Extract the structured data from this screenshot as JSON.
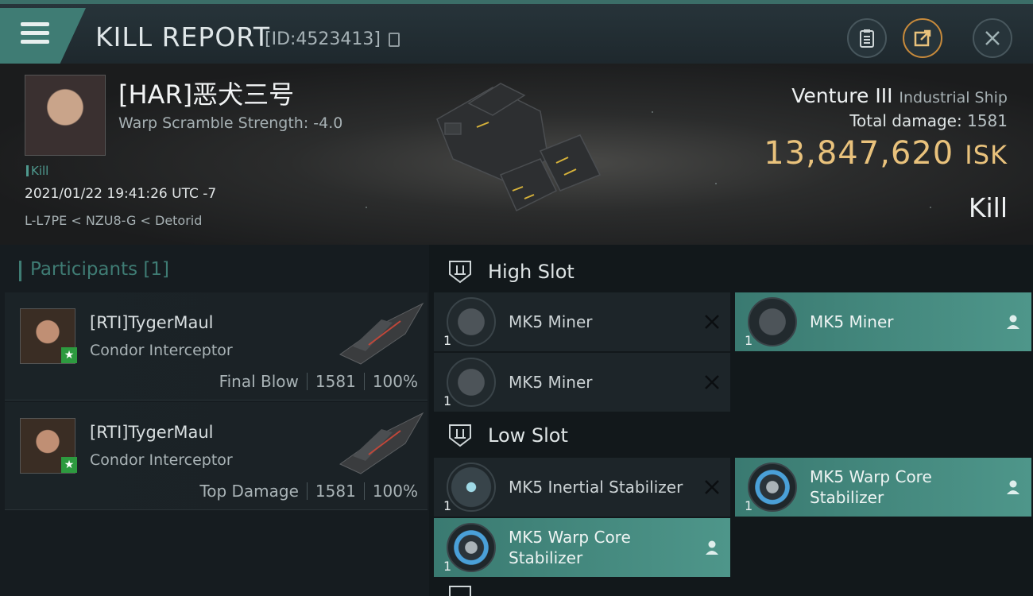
{
  "header": {
    "title": "KILL REPORT",
    "report_id": "[ID:4523413]",
    "buttons": [
      "clipboard-icon",
      "share-icon",
      "close-icon"
    ]
  },
  "victim": {
    "name": "[HAR]恶犬三号",
    "warp_scramble": "Warp Scramble Strength: -4.0",
    "tag": "Kill",
    "datetime": "2021/01/22 19:41:26 UTC -7",
    "location": "L-L7PE < NZU8-G < Detorid",
    "ship": "Venture III",
    "ship_class": "Industrial Ship",
    "total_damage_label": "Total damage:",
    "total_damage": "1581",
    "isk_value": "13,847,620",
    "isk_unit": "ISK",
    "kill_type": "Kill"
  },
  "participants": {
    "heading": "Participants [1]",
    "items": [
      {
        "name": "[RTI]TygerMaul",
        "ship": "Condor Interceptor",
        "role": "Final Blow",
        "damage": "1581",
        "percent": "100%"
      },
      {
        "name": "[RTI]TygerMaul",
        "ship": "Condor Interceptor",
        "role": "Top Damage",
        "damage": "1581",
        "percent": "100%"
      }
    ]
  },
  "slots": {
    "high": {
      "title": "High Slot",
      "modules": [
        {
          "name": "MK5 Miner",
          "qty": "1",
          "status": "destroyed"
        },
        {
          "name": "MK5 Miner",
          "qty": "1",
          "status": "dropped"
        },
        {
          "name": "MK5 Miner",
          "qty": "1",
          "status": "destroyed"
        }
      ]
    },
    "low": {
      "title": "Low Slot",
      "modules": [
        {
          "name": "MK5 Inertial Stabilizer",
          "qty": "1",
          "status": "destroyed"
        },
        {
          "name": "MK5 Warp Core Stabilizer",
          "qty": "1",
          "status": "dropped"
        },
        {
          "name": "MK5 Warp Core Stabilizer",
          "qty": "1",
          "status": "dropped"
        }
      ]
    }
  },
  "colors": {
    "accent": "#3f7c74",
    "isk": "#e9c27c",
    "dropped_bg": "#4e968a"
  }
}
